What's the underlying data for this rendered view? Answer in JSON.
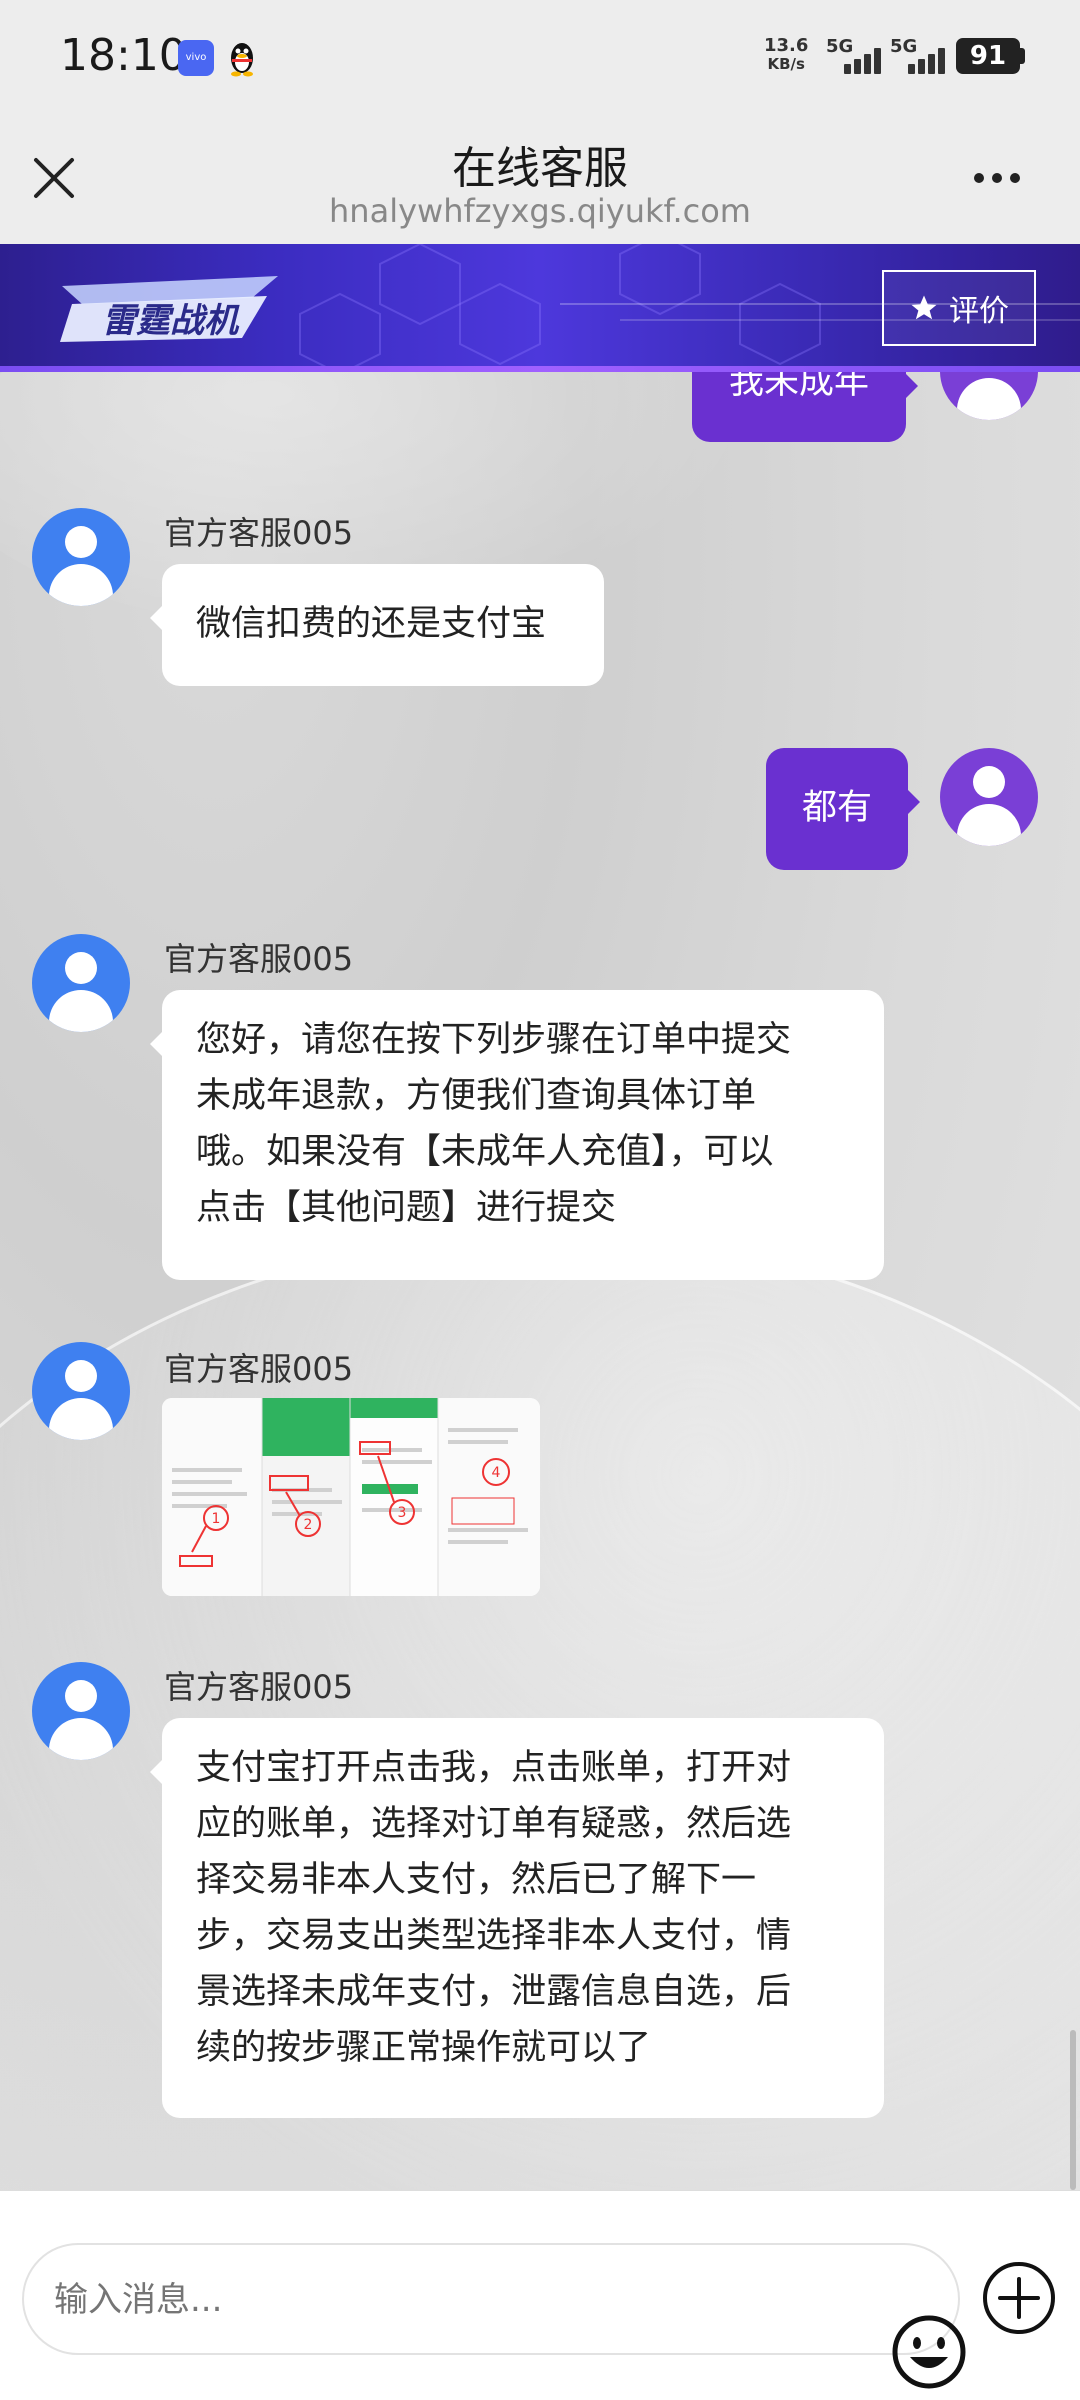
{
  "status": {
    "time": "18:10",
    "net_speed_value": "13.6",
    "net_speed_unit": "KB/s",
    "sim1": "5G",
    "sim2": "5G",
    "battery": "91"
  },
  "header": {
    "title": "在线客服",
    "subtitle": "hnalywhfzyxgs.qiyukf.com"
  },
  "banner": {
    "rate_label": "评价"
  },
  "messages": [
    {
      "from": "me",
      "text": "我未成年"
    },
    {
      "from": "agent",
      "name": "官方客服005",
      "text": "微信扣费的还是支付宝"
    },
    {
      "from": "me",
      "text": "都有"
    },
    {
      "from": "agent",
      "name": "官方客服005",
      "lines": [
        "您好，请您在按下列步骤在订单中提交",
        "未成年退款，方便我们查询具体订单",
        "哦。如果没有【未成年人充值】，可以",
        "点击【其他问题】进行提交"
      ]
    },
    {
      "from": "agent",
      "name": "官方客服005",
      "type": "image"
    },
    {
      "from": "agent",
      "name": "官方客服005",
      "lines": [
        "支付宝打开点击我，点击账单，打开对",
        "应的账单，选择对订单有疑惑，然后选",
        "择交易非本人支付，然后已了解下一",
        "步，交易支出类型选择非本人支付，情",
        "景选择未成年支付，泄露信息自选，后",
        "续的按步骤正常操作就可以了"
      ]
    }
  ],
  "input": {
    "placeholder": "输入消息..."
  },
  "colors": {
    "agent_avatar": "#3f80f0",
    "user_bubble": "#6a30d0",
    "banner": "#3b2cc0"
  }
}
